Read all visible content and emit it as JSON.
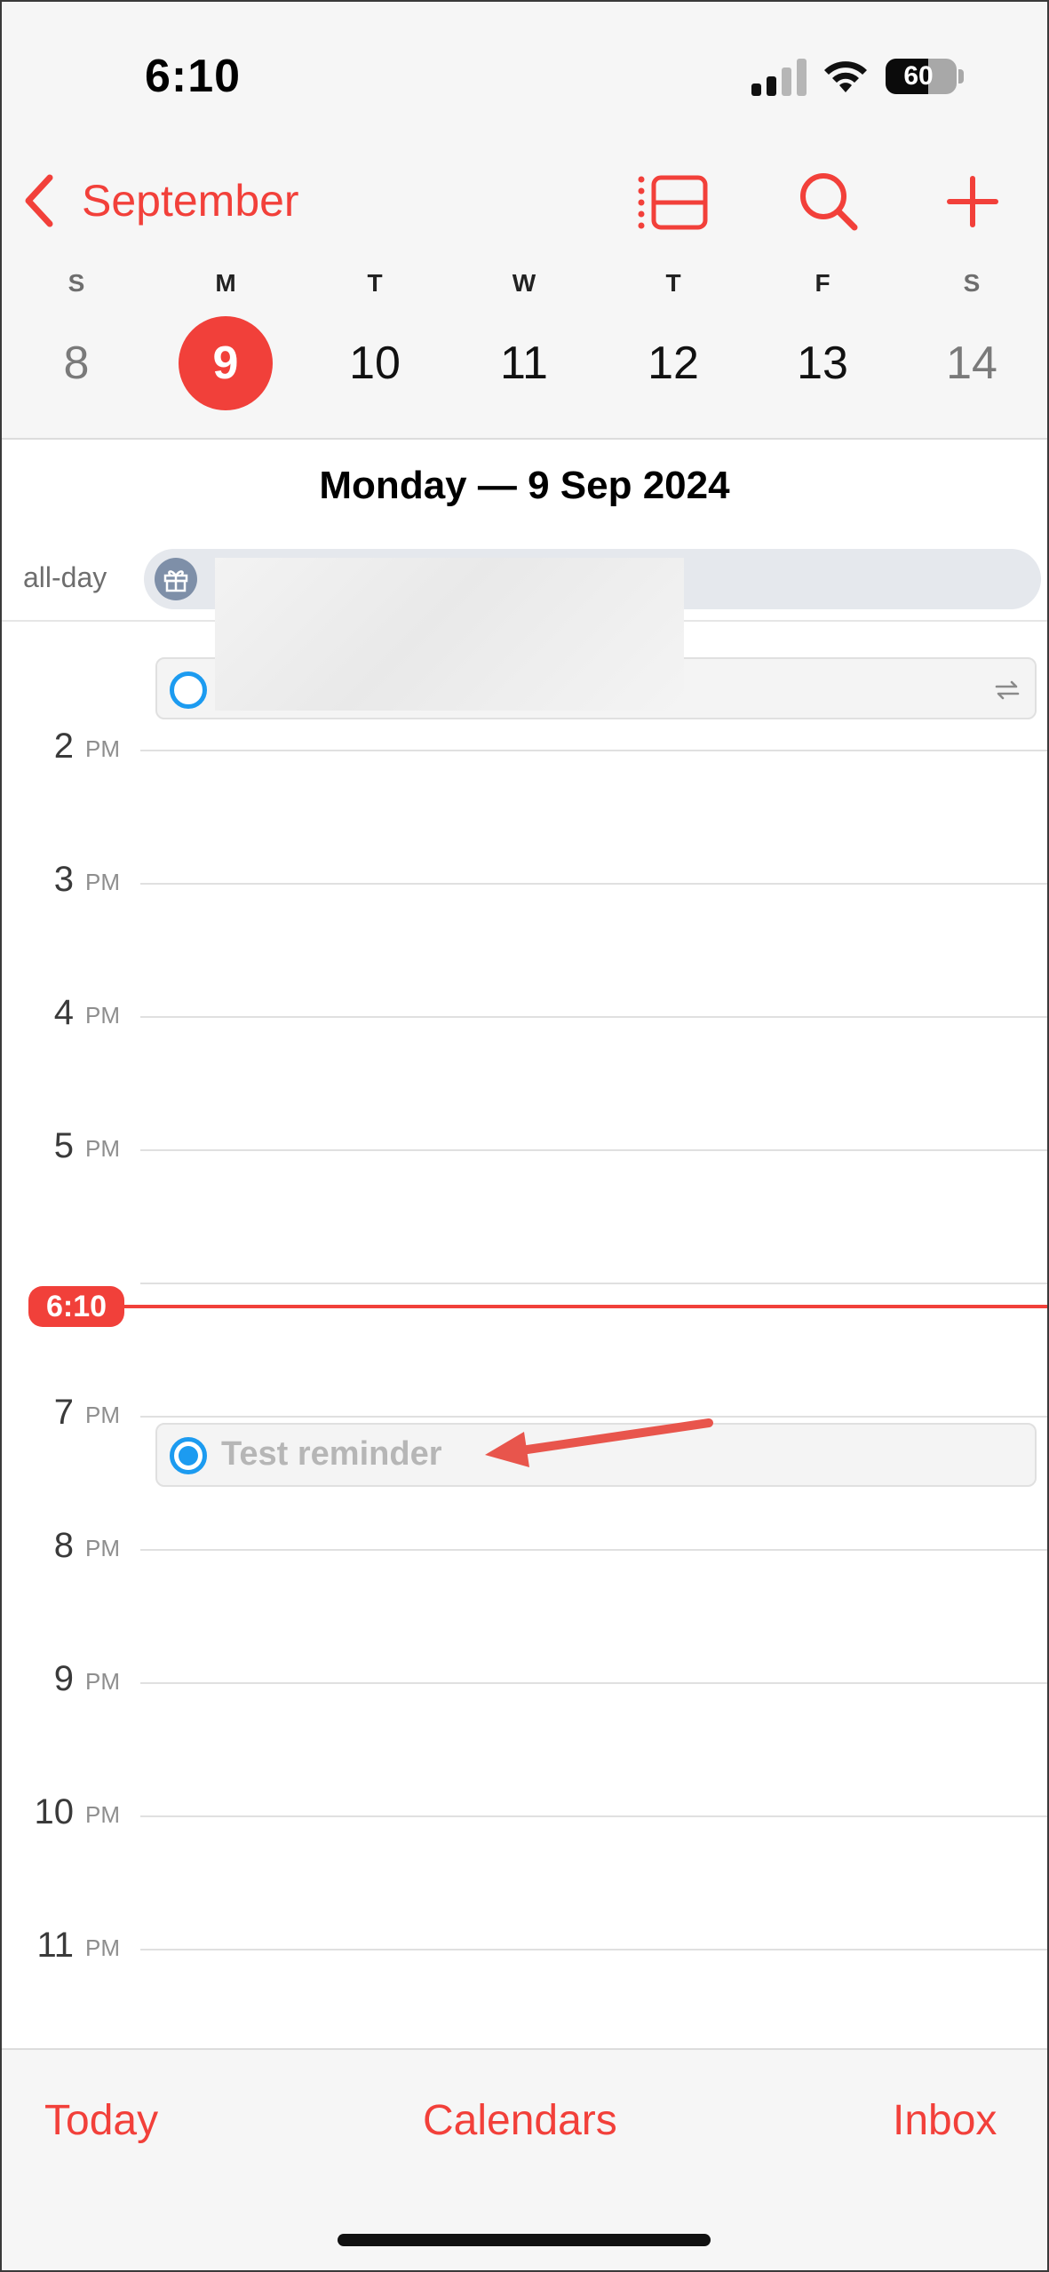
{
  "status_bar": {
    "time": "6:10",
    "battery_level": "60",
    "signal_bars_active": 2
  },
  "nav": {
    "back_label": "September"
  },
  "week": {
    "days": [
      {
        "dow": "S",
        "date": "8",
        "weekend": true,
        "selected": false
      },
      {
        "dow": "M",
        "date": "9",
        "weekend": false,
        "selected": true
      },
      {
        "dow": "T",
        "date": "10",
        "weekend": false,
        "selected": false
      },
      {
        "dow": "W",
        "date": "11",
        "weekend": false,
        "selected": false
      },
      {
        "dow": "T",
        "date": "12",
        "weekend": false,
        "selected": false
      },
      {
        "dow": "F",
        "date": "13",
        "weekend": false,
        "selected": false
      },
      {
        "dow": "S",
        "date": "14",
        "weekend": true,
        "selected": false
      }
    ]
  },
  "day_title": "Monday — 9 Sep 2024",
  "all_day": {
    "label": "all-day"
  },
  "hours": [
    {
      "num": "2",
      "ampm": "PM"
    },
    {
      "num": "3",
      "ampm": "PM"
    },
    {
      "num": "4",
      "ampm": "PM"
    },
    {
      "num": "5",
      "ampm": "PM"
    },
    {
      "num": "7",
      "ampm": "PM"
    },
    {
      "num": "8",
      "ampm": "PM"
    },
    {
      "num": "9",
      "ampm": "PM"
    },
    {
      "num": "10",
      "ampm": "PM"
    },
    {
      "num": "11",
      "ampm": "PM"
    }
  ],
  "now_indicator": "6:10",
  "reminders": {
    "test_title": "Test reminder"
  },
  "tabs": {
    "today": "Today",
    "calendars": "Calendars",
    "inbox": "Inbox"
  },
  "colors": {
    "accent": "#f1403a",
    "reminder_blue": "#1c9bf0"
  }
}
